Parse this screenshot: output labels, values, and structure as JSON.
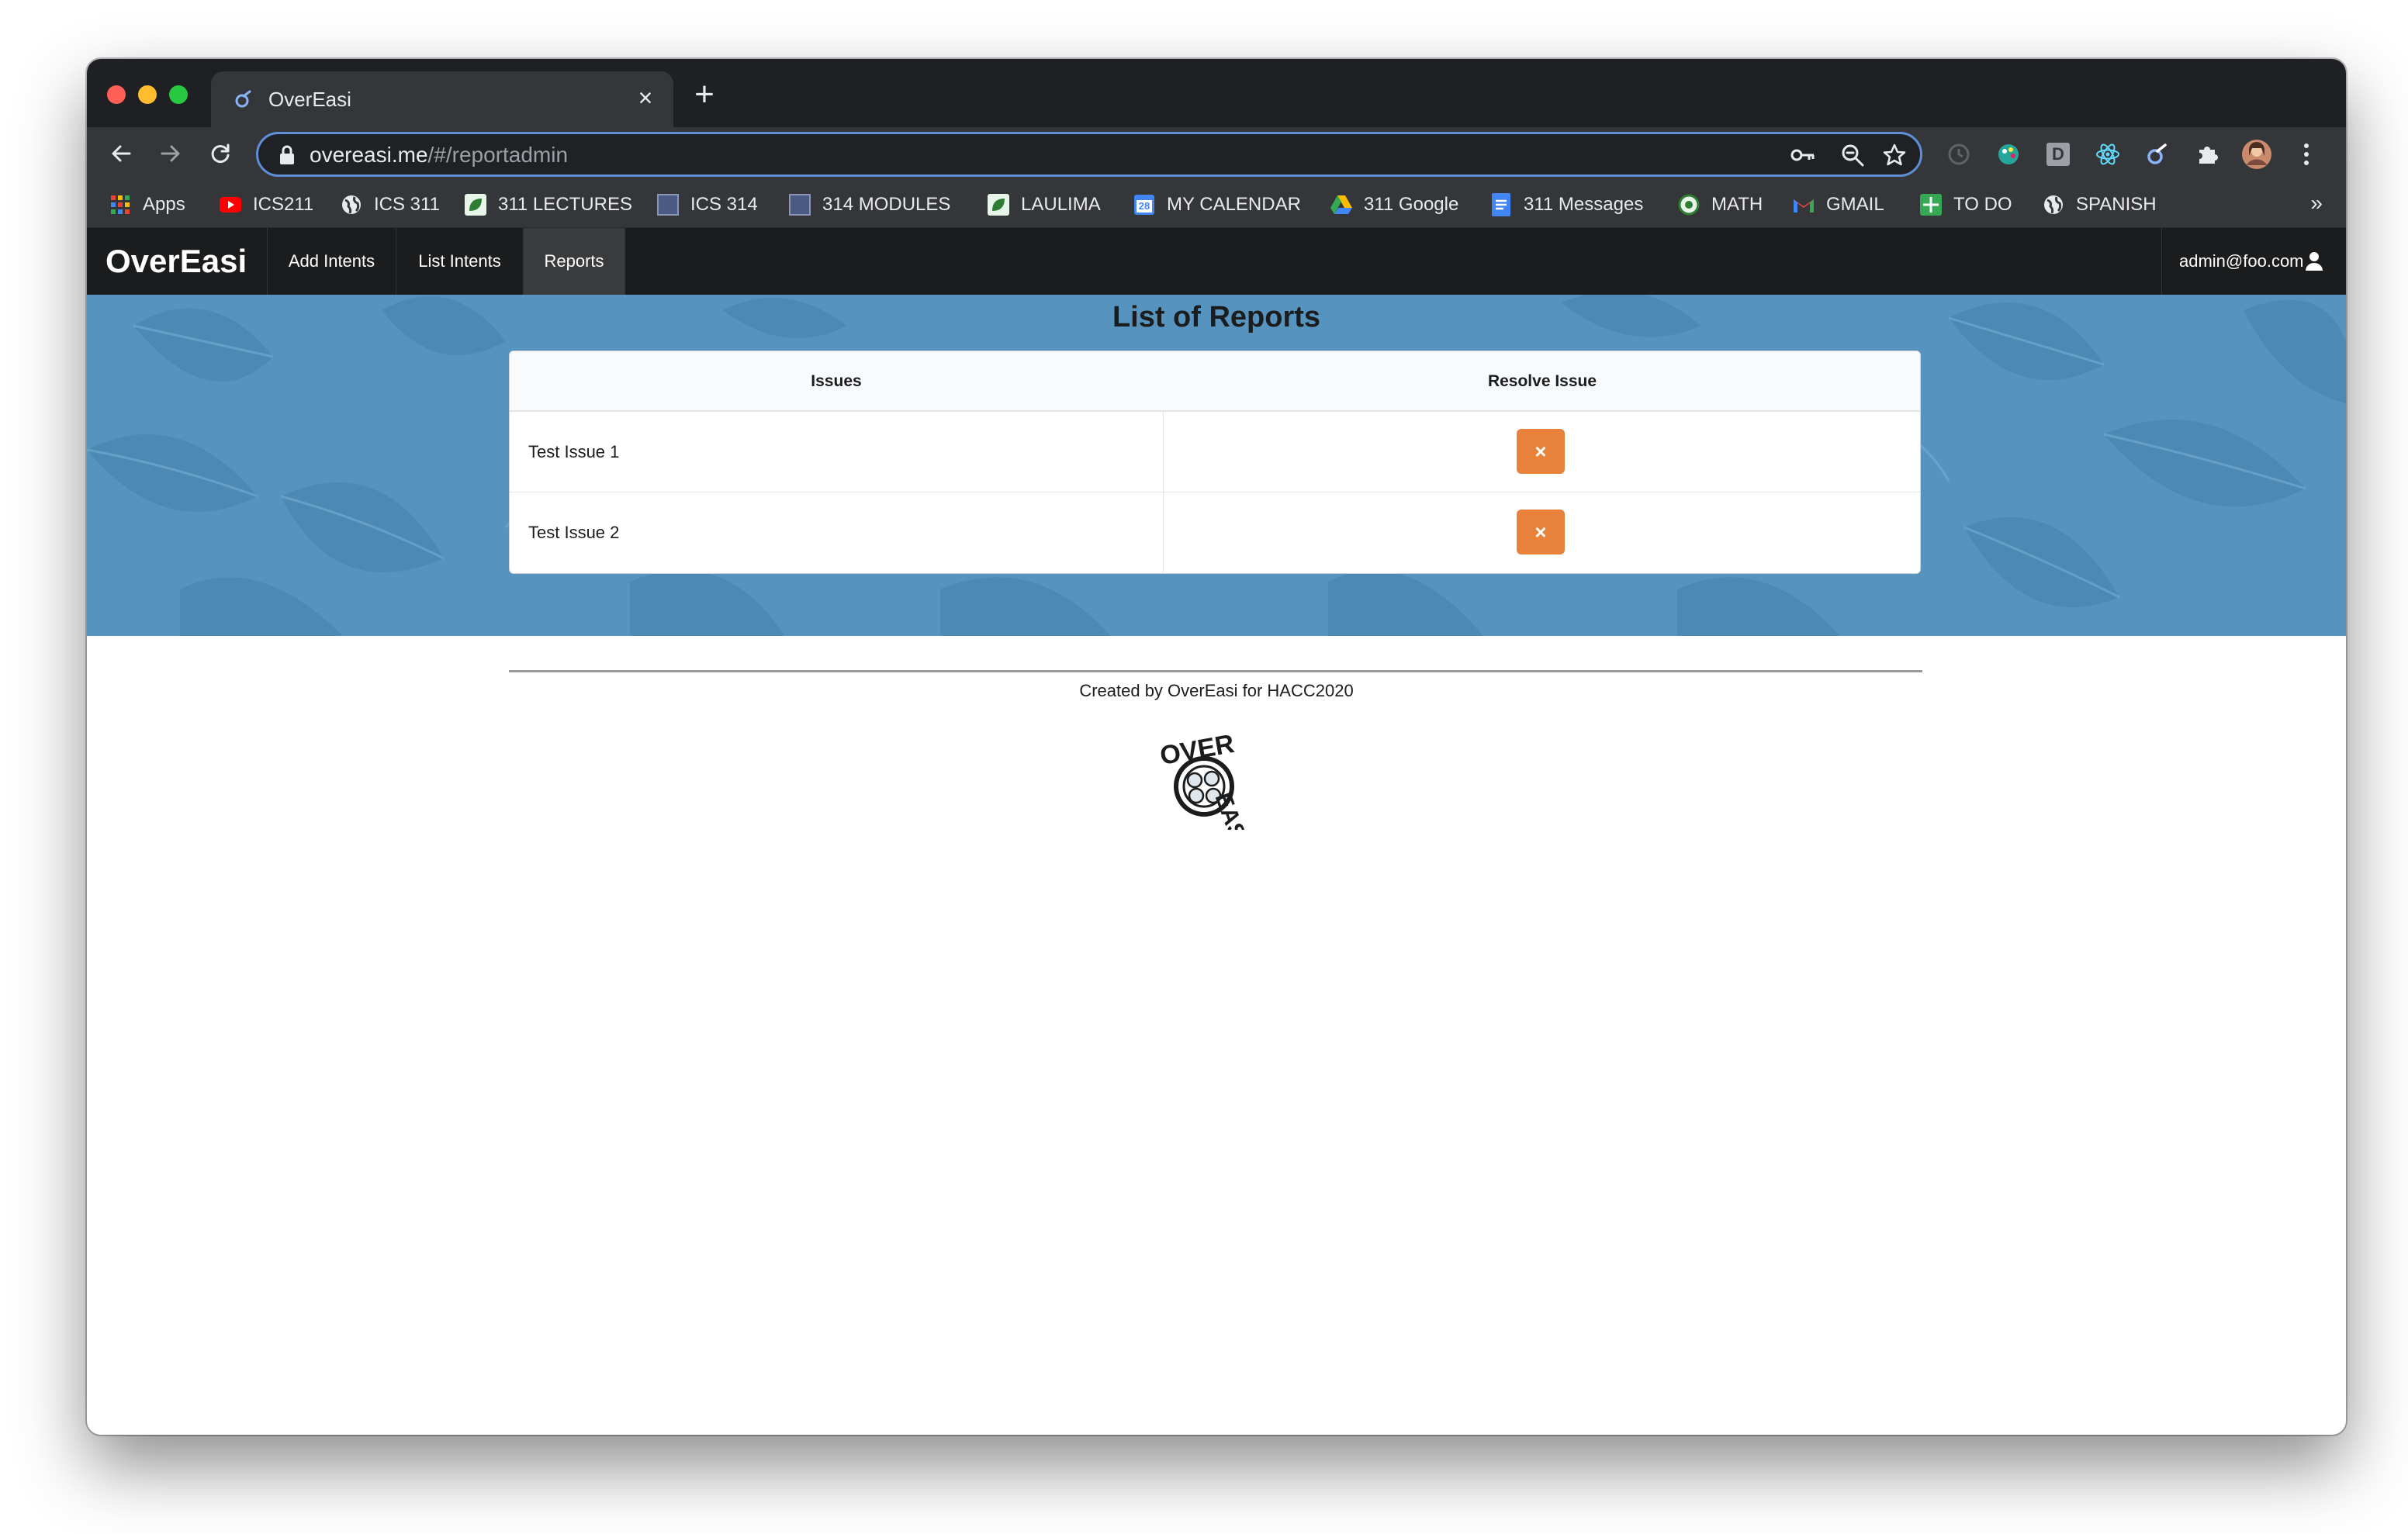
{
  "browser": {
    "tab_title": "OverEasi",
    "tab_close": "×",
    "new_tab": "+",
    "url_host": "overeasi.me",
    "url_path": "/#/reportadmin",
    "bookmarks_more": "»",
    "bookmarks": [
      {
        "label": "Apps",
        "icon": "apps-grid-icon"
      },
      {
        "label": "ICS211",
        "icon": "youtube-icon"
      },
      {
        "label": "ICS 311",
        "icon": "globe-icon"
      },
      {
        "label": "311 LECTURES",
        "icon": "leaf-icon"
      },
      {
        "label": "ICS 314",
        "icon": "square-icon"
      },
      {
        "label": "314 MODULES",
        "icon": "square-icon"
      },
      {
        "label": "LAULIMA",
        "icon": "leaf-icon"
      },
      {
        "label": "MY CALENDAR",
        "icon": "calendar-icon"
      },
      {
        "label": "311 Google",
        "icon": "drive-icon"
      },
      {
        "label": "311 Messages",
        "icon": "docs-icon"
      },
      {
        "label": "MATH",
        "icon": "circle-icon"
      },
      {
        "label": "GMAIL",
        "icon": "gmail-icon"
      },
      {
        "label": "TO DO",
        "icon": "sheets-icon"
      },
      {
        "label": "SPANISH",
        "icon": "globe-icon"
      }
    ],
    "calendar_day": "28",
    "extension_badge": "D",
    "accent_color": "#5e8fd7"
  },
  "app": {
    "brand": "OverEasi",
    "nav": {
      "add_intents": "Add Intents",
      "list_intents": "List Intents",
      "reports": "Reports",
      "user": "admin@foo.com"
    },
    "page_title": "List of Reports",
    "table": {
      "headers": [
        "Issues",
        "Resolve Issue"
      ],
      "rows": [
        {
          "issue": "Test Issue 1",
          "action": "×"
        },
        {
          "issue": "Test Issue 2",
          "action": "×"
        }
      ]
    },
    "footer_text": "Created by OverEasi for HACC2020",
    "logo_text": [
      "OVER",
      "EASI"
    ],
    "colors": {
      "hero": "#5694bf",
      "resolve_button": "#e8823a",
      "navbar": "#1b1c1d"
    }
  }
}
